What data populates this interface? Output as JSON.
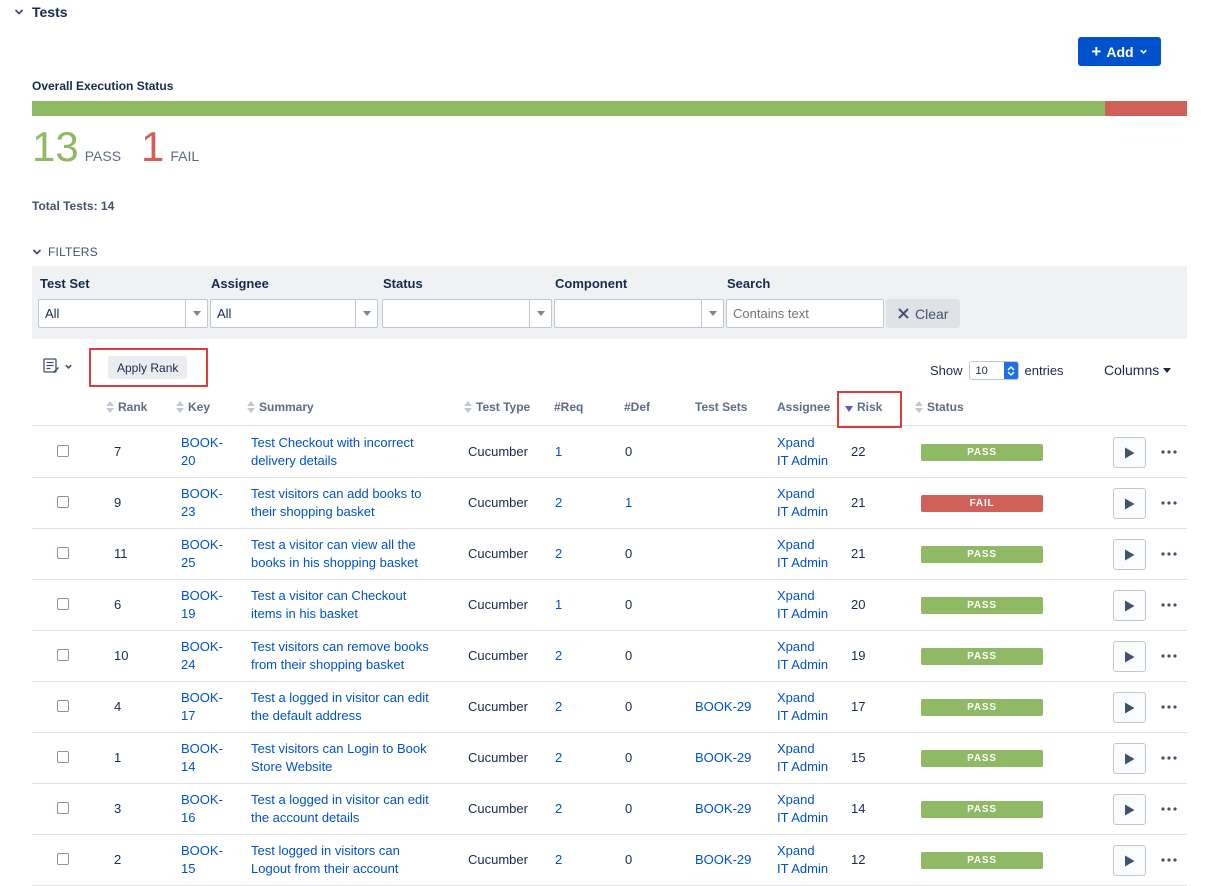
{
  "section": {
    "title": "Tests"
  },
  "toolbar": {
    "add_label": "Add"
  },
  "execution": {
    "label": "Overall Execution Status",
    "pass_count": "13",
    "pass_label": "PASS",
    "fail_count": "1",
    "fail_label": "FAIL",
    "pass_fraction": 0.929,
    "total_label": "Total Tests: 14",
    "colors": {
      "pass": "#8fb964",
      "fail": "#d0615a"
    }
  },
  "filters": {
    "toggle_label": "FILTERS",
    "test_set": {
      "label": "Test Set",
      "value": "All"
    },
    "assignee": {
      "label": "Assignee",
      "value": "All"
    },
    "status": {
      "label": "Status",
      "value": ""
    },
    "component": {
      "label": "Component",
      "value": ""
    },
    "search": {
      "label": "Search",
      "placeholder": "Contains text"
    },
    "clear_label": "Clear"
  },
  "table_controls": {
    "apply_rank_label": "Apply Rank",
    "show_label": "Show",
    "entries_value": "10",
    "entries_label": "entries",
    "columns_label": "Columns"
  },
  "columns": {
    "rank": "Rank",
    "key": "Key",
    "summary": "Summary",
    "test_type": "Test Type",
    "req": "#Req",
    "def": "#Def",
    "test_sets": "Test Sets",
    "assignee": "Assignee",
    "risk": "Risk",
    "status": "Status"
  },
  "rows": [
    {
      "rank": "7",
      "key1": "BOOK-",
      "key2": "20",
      "sum1": "Test Checkout with incorrect",
      "sum2": "delivery details",
      "type": "Cucumber",
      "req": "1",
      "def": "0",
      "sets": "",
      "as1": "Xpand",
      "as2": "IT Admin",
      "risk": "22",
      "status": "PASS"
    },
    {
      "rank": "9",
      "key1": "BOOK-",
      "key2": "23",
      "sum1": "Test visitors can add books to",
      "sum2": "their shopping basket",
      "type": "Cucumber",
      "req": "2",
      "def": "1",
      "sets": "",
      "as1": "Xpand",
      "as2": "IT Admin",
      "risk": "21",
      "status": "FAIL"
    },
    {
      "rank": "11",
      "key1": "BOOK-",
      "key2": "25",
      "sum1": "Test a visitor can view all the",
      "sum2": "books in his shopping basket",
      "type": "Cucumber",
      "req": "2",
      "def": "0",
      "sets": "",
      "as1": "Xpand",
      "as2": "IT Admin",
      "risk": "21",
      "status": "PASS"
    },
    {
      "rank": "6",
      "key1": "BOOK-",
      "key2": "19",
      "sum1": "Test a visitor can Checkout",
      "sum2": "items in his basket",
      "type": "Cucumber",
      "req": "1",
      "def": "0",
      "sets": "",
      "as1": "Xpand",
      "as2": "IT Admin",
      "risk": "20",
      "status": "PASS"
    },
    {
      "rank": "10",
      "key1": "BOOK-",
      "key2": "24",
      "sum1": "Test visitors can remove books",
      "sum2": "from their shopping basket",
      "type": "Cucumber",
      "req": "2",
      "def": "0",
      "sets": "",
      "as1": "Xpand",
      "as2": "IT Admin",
      "risk": "19",
      "status": "PASS"
    },
    {
      "rank": "4",
      "key1": "BOOK-",
      "key2": "17",
      "sum1": "Test a logged in visitor can edit",
      "sum2": "the default address",
      "type": "Cucumber",
      "req": "2",
      "def": "0",
      "sets": "BOOK-29",
      "as1": "Xpand",
      "as2": "IT Admin",
      "risk": "17",
      "status": "PASS"
    },
    {
      "rank": "1",
      "key1": "BOOK-",
      "key2": "14",
      "sum1": "Test visitors can Login to Book",
      "sum2": "Store Website",
      "type": "Cucumber",
      "req": "2",
      "def": "0",
      "sets": "BOOK-29",
      "as1": "Xpand",
      "as2": "IT Admin",
      "risk": "15",
      "status": "PASS"
    },
    {
      "rank": "3",
      "key1": "BOOK-",
      "key2": "16",
      "sum1": "Test a logged in visitor can edit",
      "sum2": "the account details",
      "type": "Cucumber",
      "req": "2",
      "def": "0",
      "sets": "BOOK-29",
      "as1": "Xpand",
      "as2": "IT Admin",
      "risk": "14",
      "status": "PASS"
    },
    {
      "rank": "2",
      "key1": "BOOK-",
      "key2": "15",
      "sum1": "Test logged in visitors can",
      "sum2": "Logout from their account",
      "type": "Cucumber",
      "req": "2",
      "def": "0",
      "sets": "BOOK-29",
      "as1": "Xpand",
      "as2": "IT Admin",
      "risk": "12",
      "status": "PASS"
    }
  ]
}
